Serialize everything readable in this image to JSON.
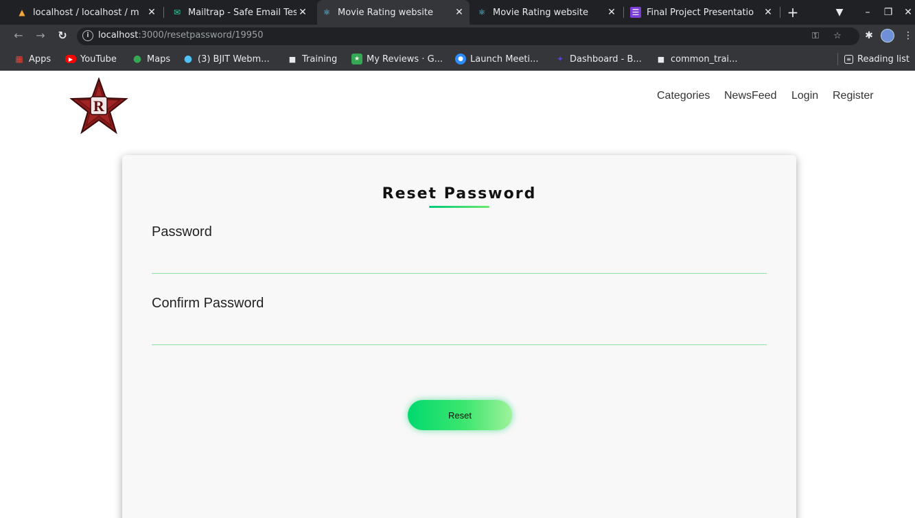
{
  "browser": {
    "tabs": [
      {
        "title": "localhost / localhost / m",
        "favicon": "phpmyadmin-icon",
        "active": false
      },
      {
        "title": "Mailtrap - Safe Email Tes",
        "favicon": "mailtrap-icon",
        "active": false
      },
      {
        "title": "Movie Rating website",
        "favicon": "react-icon",
        "active": true
      },
      {
        "title": "Movie Rating website",
        "favicon": "react-icon",
        "active": false
      },
      {
        "title": "Final Project Presentatio",
        "favicon": "slides-icon",
        "active": false
      }
    ],
    "new_tab_label": "+",
    "url_host": "localhost",
    "url_path": ":3000/resetpassword/19950",
    "bookmarks": [
      {
        "label": "Apps",
        "icon": "apps-grid-icon"
      },
      {
        "label": "YouTube",
        "icon": "youtube-icon"
      },
      {
        "label": "Maps",
        "icon": "maps-icon"
      },
      {
        "label": "(3) BJIT Webm...",
        "icon": "webmail-icon"
      },
      {
        "label": "Training",
        "icon": "folder-icon"
      },
      {
        "label": "My Reviews · G...",
        "icon": "reviews-icon"
      },
      {
        "label": "Launch Meeti...",
        "icon": "zoom-icon"
      },
      {
        "label": "Dashboard - B...",
        "icon": "dashboard-icon"
      },
      {
        "label": "common_trai...",
        "icon": "folder-icon"
      }
    ],
    "reading_list_label": "Reading list"
  },
  "site": {
    "nav": {
      "categories": "Categories",
      "newsfeed": "NewsFeed",
      "login": "Login",
      "register": "Register"
    }
  },
  "form": {
    "title": "Reset Password",
    "password_label": "Password",
    "password_value": "",
    "confirm_label": "Confirm Password",
    "confirm_value": "",
    "submit_label": "Reset"
  },
  "colors": {
    "accent_green": "#00d96e",
    "accent_light_green": "#9ff29a",
    "card_background": "#f8f8f8",
    "logo_star": "#8b1a1a"
  }
}
